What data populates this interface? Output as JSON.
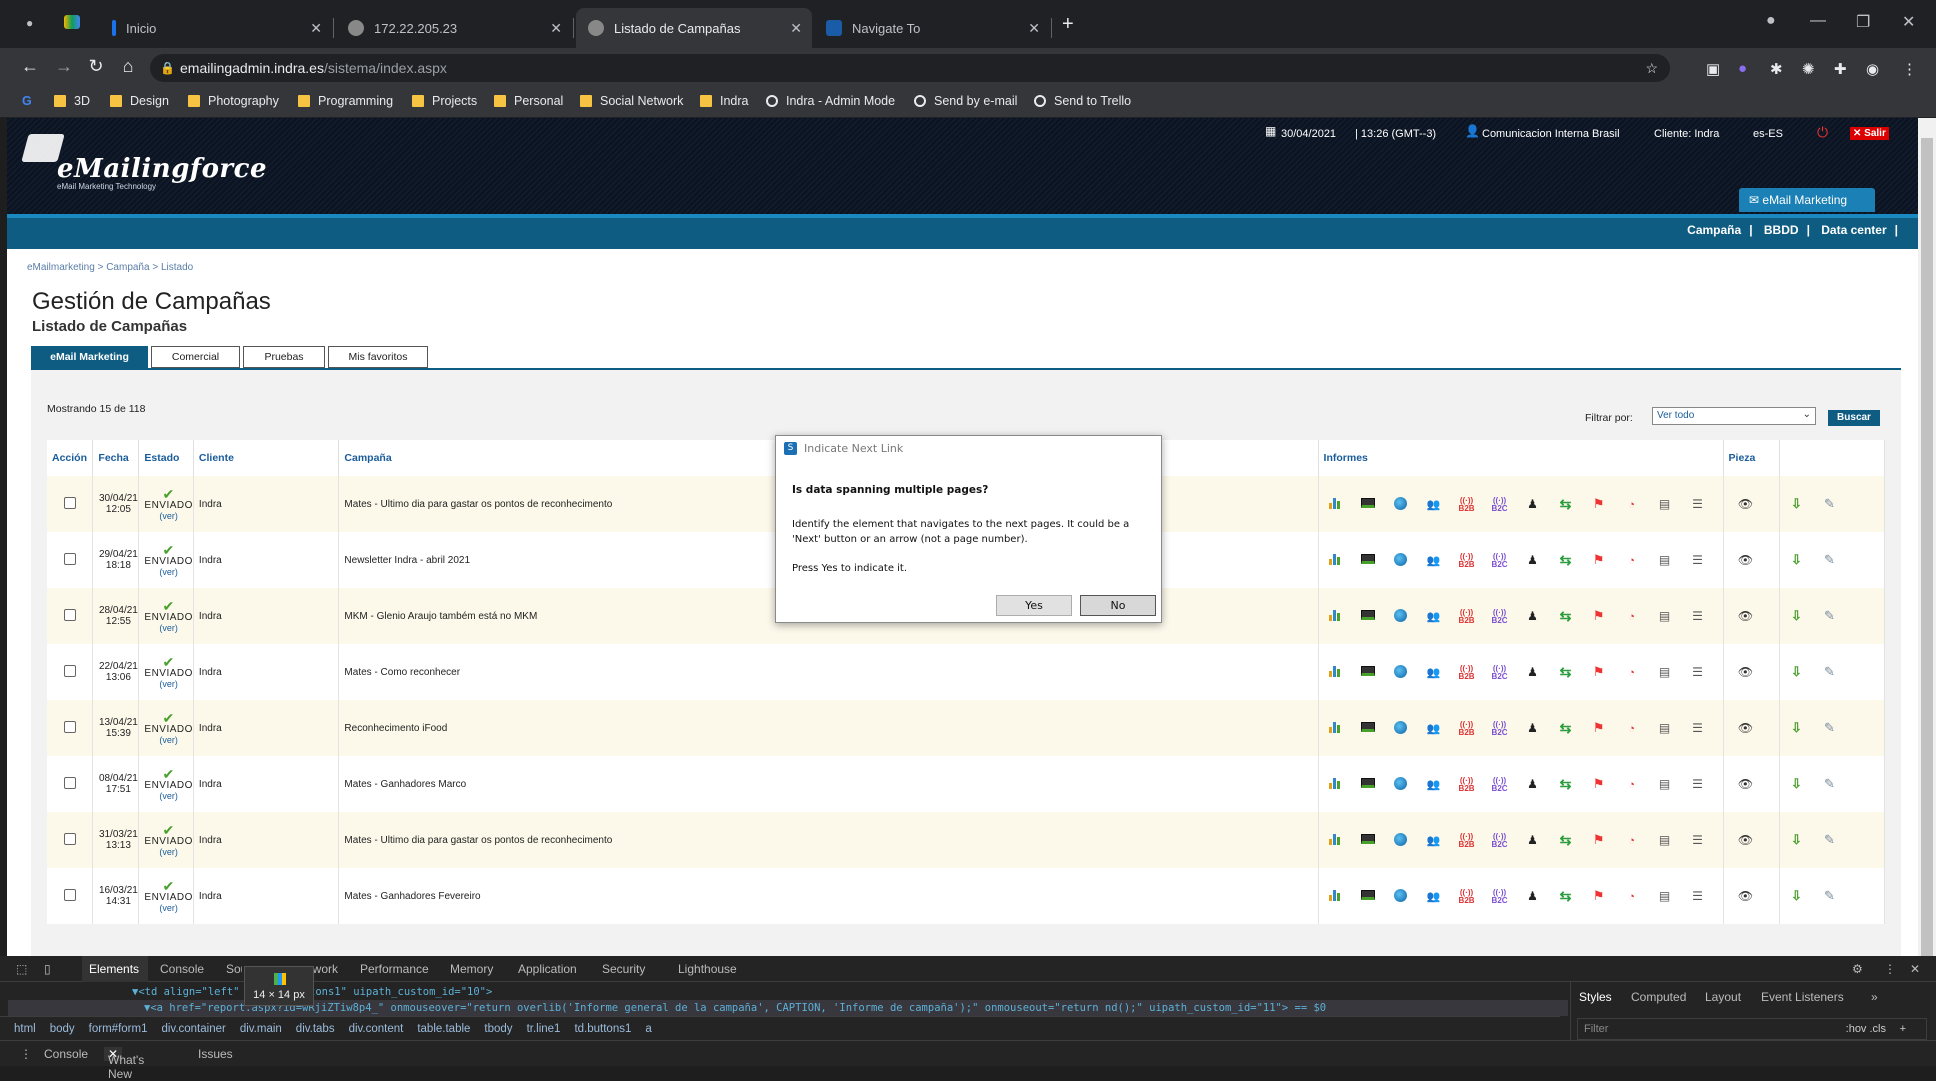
{
  "browser": {
    "tabs": [
      {
        "label": "Inicio",
        "fav": "#1a73e8"
      },
      {
        "label": "172.22.205.23",
        "fav": "#888888"
      },
      {
        "label": "Listado de Campañas",
        "fav": "#888888"
      },
      {
        "label": "Navigate To",
        "fav": "#1a5ca8"
      }
    ],
    "url_host": "emailingadmin.indra.es",
    "url_path": "/sistema/index.aspx",
    "bookmarks": [
      "3D",
      "Design",
      "Photography",
      "Programming",
      "Projects",
      "Personal",
      "Social Network",
      "Indra",
      "Indra - Admin Mode",
      "Send by e-mail",
      "Send to Trello"
    ]
  },
  "header": {
    "brand": "eMailingforce",
    "tagline": "eMail Marketing Technology",
    "date": "30/04/2021",
    "time": "| 13:26 (GMT--3)",
    "user": "Comunicacion Interna Brasil",
    "client": "Cliente: Indra",
    "locale": "es-ES",
    "logout": "Salir",
    "module_tab": "eMail Marketing",
    "menu": [
      "Campaña",
      "BBDD",
      "Data center"
    ]
  },
  "page": {
    "breadcrumb": "eMailmarketing > Campaña > Listado",
    "title": "Gestión de Campañas",
    "subtitle": "Listado de Campañas",
    "tabs": [
      "eMail Marketing",
      "Comercial",
      "Pruebas",
      "Mis favoritos"
    ],
    "showing": "Mostrando 15 de 118",
    "filter_label": "Filtrar por:",
    "filter_value": "Ver todo",
    "search_button": "Buscar",
    "columns": [
      "Acción",
      "Fecha",
      "Estado",
      "Cliente",
      "Campaña",
      "Informes",
      "Pieza",
      ""
    ],
    "status_text": "ENVIADO",
    "status_link": "(ver)",
    "rows": [
      {
        "date": "30/04/21",
        "time": "12:05",
        "client": "Indra",
        "campaign": "Mates - Ultimo dia para gastar os pontos de reconhecimento"
      },
      {
        "date": "29/04/21",
        "time": "18:18",
        "client": "Indra",
        "campaign": "Newsletter Indra - abril 2021"
      },
      {
        "date": "28/04/21",
        "time": "12:55",
        "client": "Indra",
        "campaign": "MKM - Glenio Araujo também está no MKM"
      },
      {
        "date": "22/04/21",
        "time": "13:06",
        "client": "Indra",
        "campaign": "Mates - Como reconhecer"
      },
      {
        "date": "13/04/21",
        "time": "15:39",
        "client": "Indra",
        "campaign": "Reconhecimento iFood"
      },
      {
        "date": "08/04/21",
        "time": "17:51",
        "client": "Indra",
        "campaign": "Mates - Ganhadores Marco"
      },
      {
        "date": "31/03/21",
        "time": "13:13",
        "client": "Indra",
        "campaign": "Mates - Ultimo dia para gastar os pontos de reconhecimento"
      },
      {
        "date": "16/03/21",
        "time": "14:31",
        "client": "Indra",
        "campaign": "Mates - Ganhadores Fevereiro"
      }
    ],
    "report_icons": [
      "bar-chart-icon",
      "monitor-icon",
      "globe-icon",
      "users-icon",
      "b2b-icon",
      "b2c-icon",
      "person-icon",
      "refresh-icon",
      "flag-icon",
      "signal-icon",
      "delete-report-icon",
      "list-icon"
    ],
    "piece_icon": "eye-icon",
    "action_icons": [
      "download-icon",
      "edit-icon"
    ]
  },
  "dialog": {
    "title": "Indicate Next Link",
    "question": "Is data spanning multiple pages?",
    "message": "Identify the element that navigates to the next pages. It could be a 'Next' button or an arrow (not a page number).",
    "prompt": "Press Yes to indicate it.",
    "yes": "Yes",
    "no": "No"
  },
  "devtools": {
    "tabs": [
      "Elements",
      "Console",
      "Sources",
      "Network",
      "Performance",
      "Memory",
      "Application",
      "Security",
      "Lighthouse"
    ],
    "tooltip": "14 × 14 px",
    "line1": "▼<td align=\"left\" class=\"buttons1\" uipath_custom_id=\"10\">",
    "line2": "▼<a href=\"report.aspx?id=wRjiZTiw8p4_\" onmouseover=\"return overlib('Informe general de la campaña', CAPTION, 'Informe de campaña');\" onmouseout=\"return nd();\" uipath_custom_id=\"11\"> == $0",
    "path": [
      "html",
      "body",
      "form#form1",
      "div.container",
      "div.main",
      "div.tabs",
      "div.content",
      "table.table",
      "tbody",
      "tr.line1",
      "td.buttons1",
      "a"
    ],
    "side_tabs": [
      "Styles",
      "Computed",
      "Layout",
      "Event Listeners"
    ],
    "filter_placeholder": "Filter",
    "filter_tools": ":hov .cls",
    "drawer": [
      "Console",
      "What's New",
      "Issues"
    ]
  }
}
